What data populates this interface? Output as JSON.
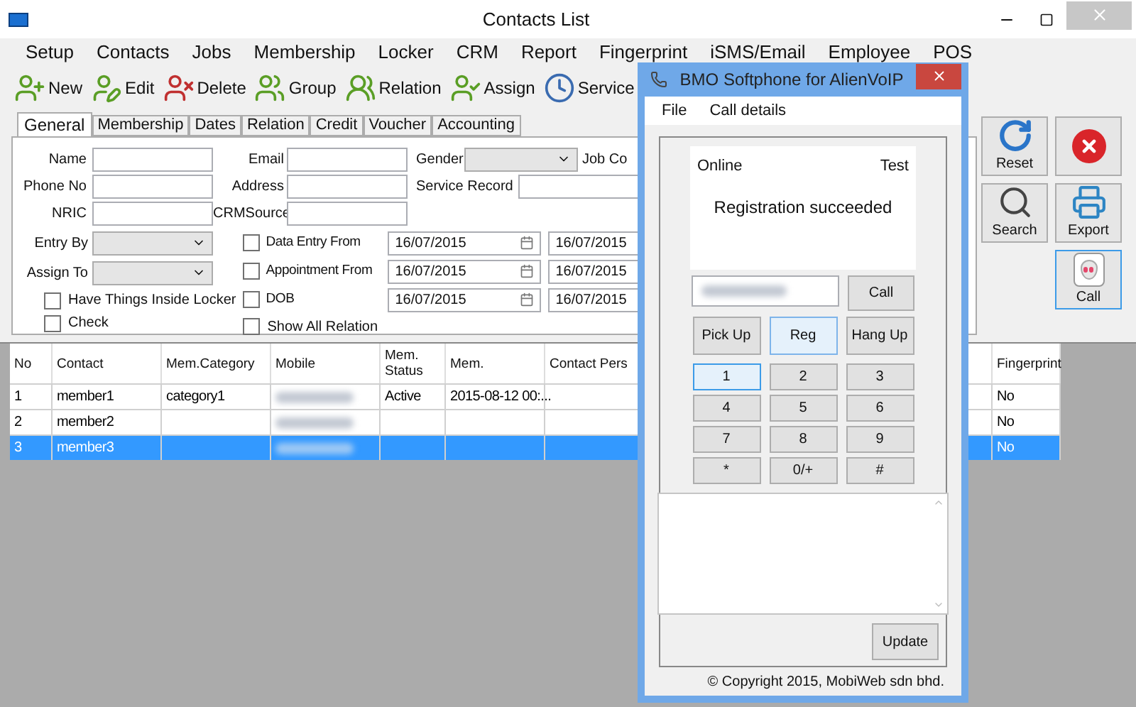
{
  "window": {
    "title": "Contacts List"
  },
  "menu": [
    "Setup",
    "Contacts",
    "Jobs",
    "Membership",
    "Locker",
    "CRM",
    "Report",
    "Fingerprint",
    "iSMS/Email",
    "Employee",
    "POS"
  ],
  "toolbar": [
    {
      "label": "New"
    },
    {
      "label": "Edit"
    },
    {
      "label": "Delete"
    },
    {
      "label": "Group"
    },
    {
      "label": "Relation"
    },
    {
      "label": "Assign"
    },
    {
      "label": "Service"
    }
  ],
  "tabs": [
    {
      "label": "General",
      "selected": true
    },
    {
      "label": "Membership",
      "selected": false
    },
    {
      "label": "Dates",
      "selected": false
    },
    {
      "label": "Relation",
      "selected": false
    },
    {
      "label": "Credit",
      "selected": false
    },
    {
      "label": "Voucher",
      "selected": false
    },
    {
      "label": "Accounting",
      "selected": false
    }
  ],
  "fields_col1": [
    "Name",
    "Phone No",
    "NRIC"
  ],
  "fields_col2": [
    "Email",
    "Address",
    "CRMSource"
  ],
  "gender_label": "Gender",
  "job_label": "Job Co",
  "service_record_label": "Service Record",
  "dropdowns": [
    "Entry By",
    "Assign To"
  ],
  "checkboxes": [
    {
      "label": "Have Things Inside Locker",
      "checked": false
    },
    {
      "label": "Check",
      "checked": false
    }
  ],
  "date_filters": [
    {
      "label": "Data Entry From",
      "checked": false,
      "from": "16/07/2015",
      "to": "16/07/2015"
    },
    {
      "label": "Appointment From",
      "checked": false,
      "from": "16/07/2015",
      "to": "16/07/2015"
    },
    {
      "label": "DOB",
      "checked": false,
      "from": "16/07/2015",
      "to": "16/07/2015"
    }
  ],
  "show_all_relation": {
    "label": "Show All Relation",
    "checked": false
  },
  "side_buttons": [
    {
      "kind": "reset",
      "label": "Reset",
      "selected": false
    },
    {
      "kind": "close",
      "selected": false
    },
    {
      "kind": "search",
      "label": "Search",
      "selected": false
    },
    {
      "kind": "export",
      "label": "Export",
      "selected": false
    },
    {
      "kind": "call",
      "label": "Call",
      "selected": true
    }
  ],
  "table": {
    "columns": [
      "No",
      "Contact",
      "Mem.Category",
      "Mobile",
      "Mem. Status",
      "Mem.",
      "Contact Pers",
      "Fingerprint"
    ],
    "rows": [
      {
        "cells": [
          "1",
          "member1",
          "category1",
          "",
          "Active",
          "2015-08-12 00:...",
          "",
          "No"
        ],
        "selected": false
      },
      {
        "cells": [
          "2",
          "member2",
          "",
          "",
          "",
          "",
          "",
          "No"
        ],
        "selected": false
      },
      {
        "cells": [
          "3",
          "member3",
          "",
          "",
          "",
          "",
          "",
          "No"
        ],
        "selected": true
      }
    ]
  },
  "softphone": {
    "title": "BMO Softphone for AlienVoIP",
    "menu": [
      "File",
      "Call details"
    ],
    "status": "Online",
    "account": "Test",
    "message": "Registration succeeded",
    "call_button": "Call",
    "actions": [
      {
        "label": "Pick Up",
        "highlighted": false
      },
      {
        "label": "Reg",
        "highlighted": true
      },
      {
        "label": "Hang Up",
        "highlighted": false
      }
    ],
    "keys": [
      {
        "label": "1",
        "focused": true
      },
      {
        "label": "2",
        "focused": false
      },
      {
        "label": "3",
        "focused": false
      },
      {
        "label": "4",
        "focused": false
      },
      {
        "label": "5",
        "focused": false
      },
      {
        "label": "6",
        "focused": false
      },
      {
        "label": "7",
        "focused": false
      },
      {
        "label": "8",
        "focused": false
      },
      {
        "label": "9",
        "focused": false
      },
      {
        "label": "*",
        "focused": false
      },
      {
        "label": "0/+",
        "focused": false
      },
      {
        "label": "#",
        "focused": false
      }
    ],
    "update_button": "Update",
    "copyright": "© Copyright 2015, MobiWeb sdn bhd."
  }
}
